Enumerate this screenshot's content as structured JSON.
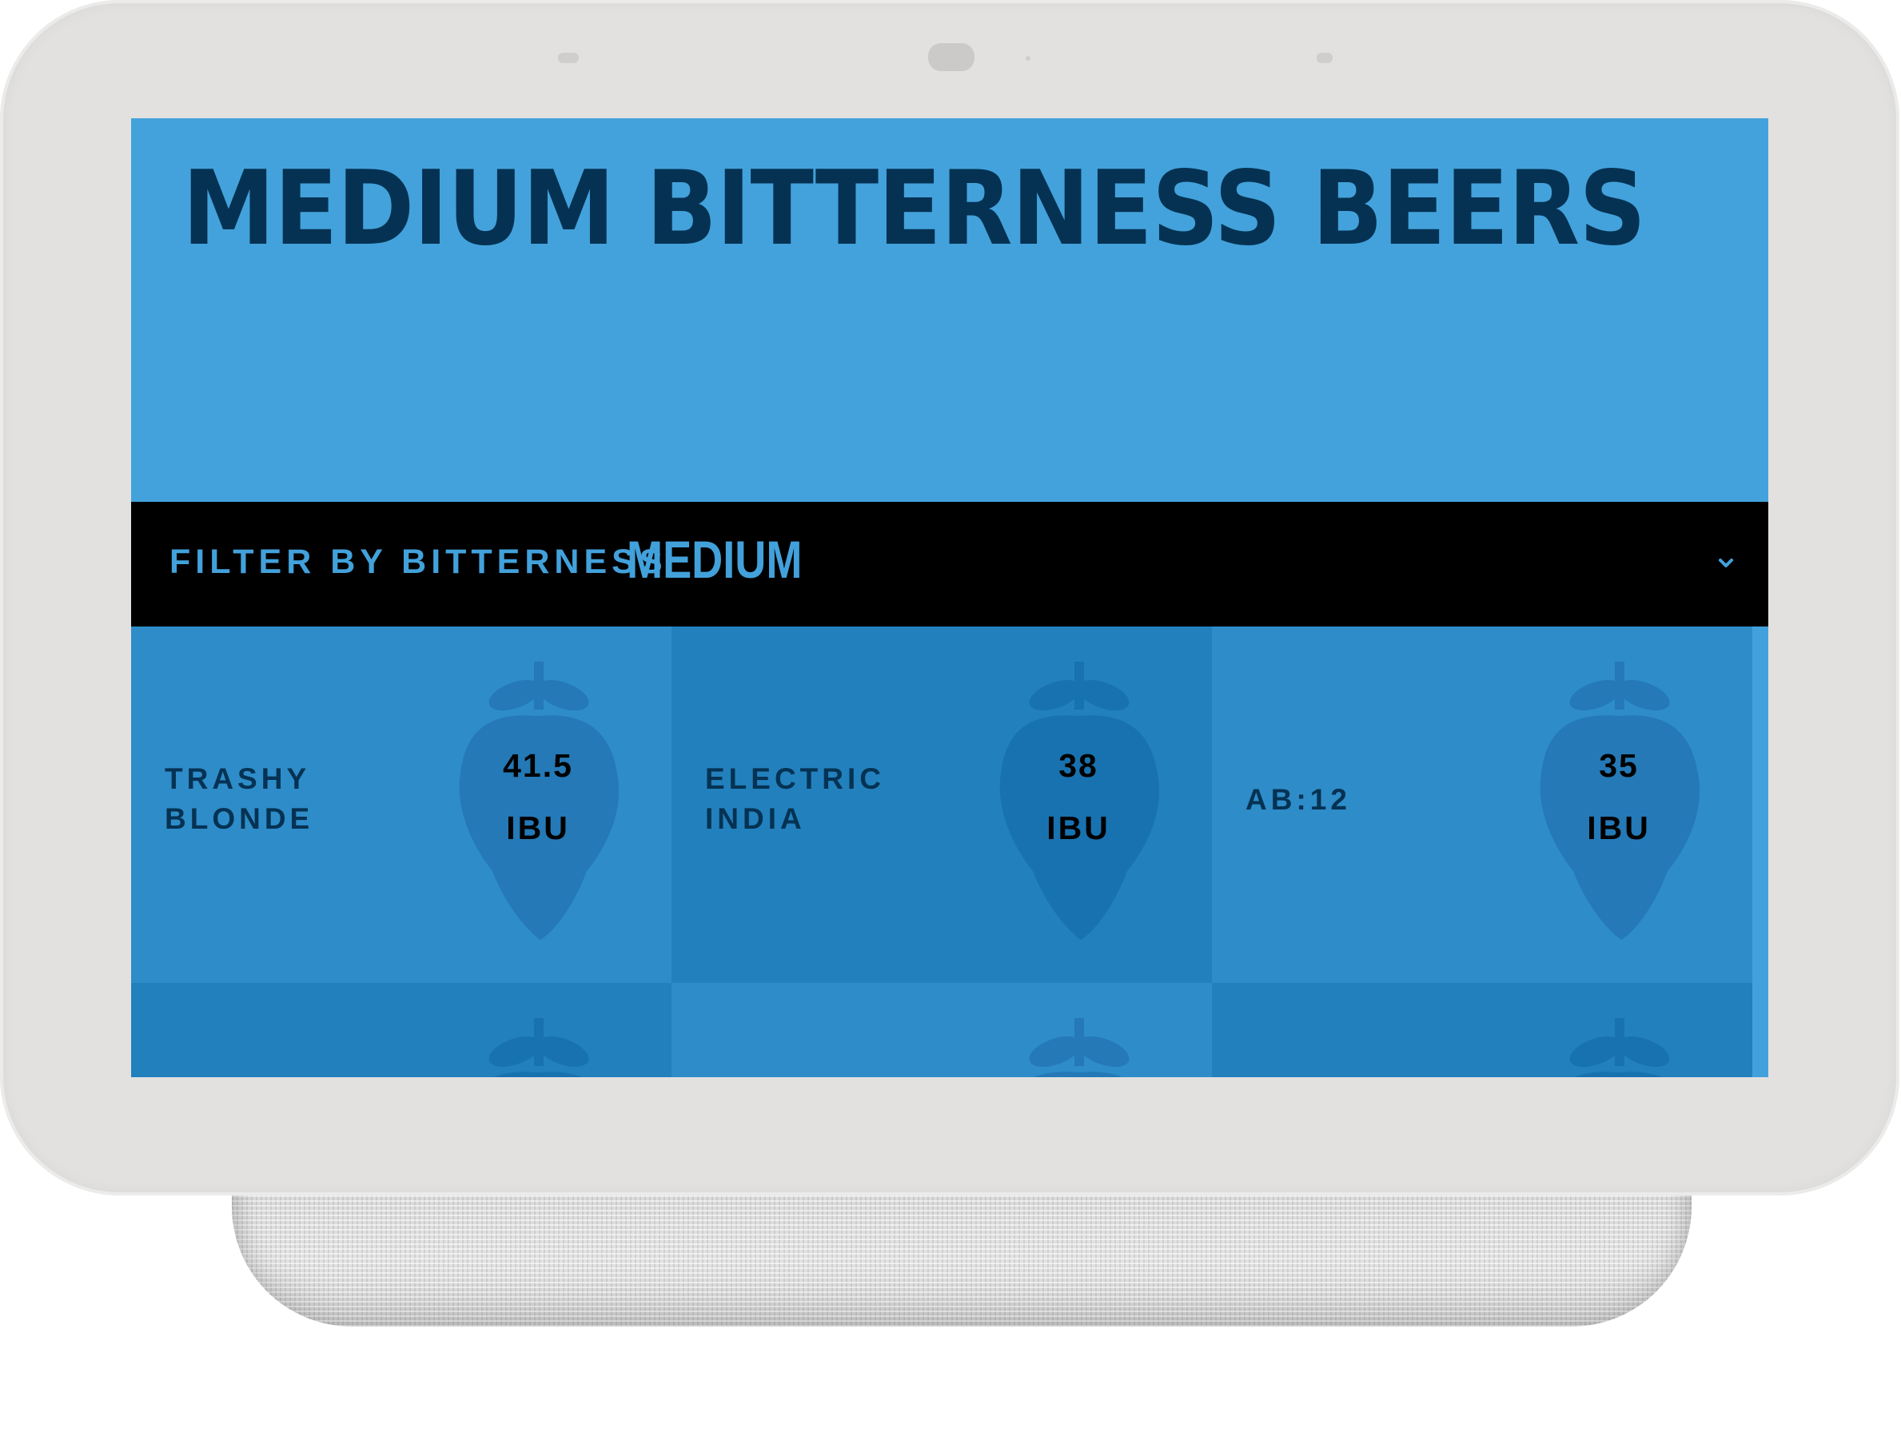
{
  "page": {
    "title": "MEDIUM BITTERNESS BEERS"
  },
  "filter": {
    "label": "FILTER BY BITTERNESS",
    "selected": "MEDIUM",
    "icon": "chevron-down-icon"
  },
  "beers": [
    {
      "name": "TRASHY BLONDE",
      "ibu": "41.5",
      "unit": "IBU"
    },
    {
      "name": "ELECTRIC INDIA",
      "ibu": "38",
      "unit": "IBU"
    },
    {
      "name": "AB:12",
      "ibu": "35",
      "unit": "IBU"
    }
  ],
  "icons": {
    "tile_background": "hop-icon"
  },
  "colors": {
    "hero": "#43a2db",
    "title": "#053253",
    "filter_bar": "#000000",
    "accent": "#42a1db",
    "tile_light": "#2e8cc8",
    "tile_dark": "#2280bd",
    "bezel": "#e2e1e0"
  }
}
